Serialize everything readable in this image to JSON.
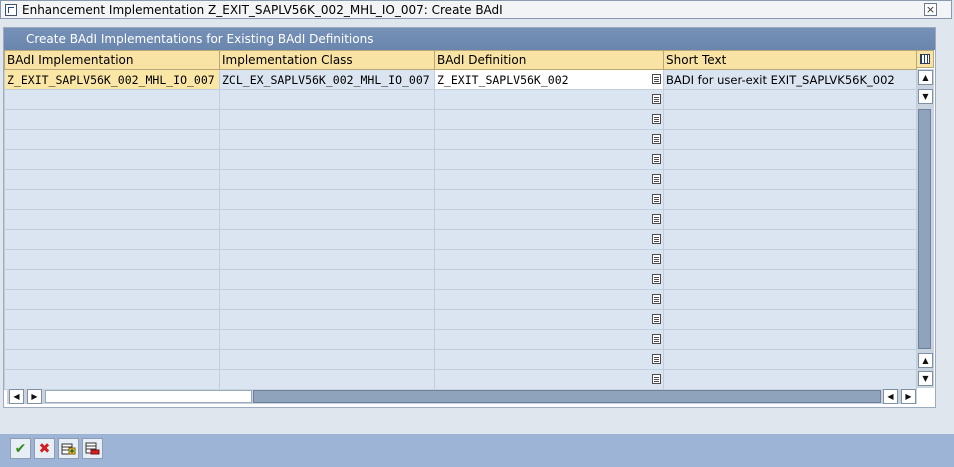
{
  "window": {
    "title": "Enhancement Implementation Z_EXIT_SAPLV56K_002_MHL_IO_007: Create BAdI"
  },
  "panel": {
    "title": "Create BAdI Implementations for Existing BAdI Definitions"
  },
  "table": {
    "columns": [
      "BAdI Implementation",
      "Implementation Class",
      "BAdI Definition",
      "Short Text"
    ],
    "rows": [
      {
        "impl": "Z_EXIT_SAPLV56K_002_MHL_IO_007",
        "cls": "ZCL_EX_SAPLV56K_002_MHL_IO_007",
        "def": "Z_EXIT_SAPLV56K_002",
        "short": "BADI for user-exit EXIT_SAPLVK56K_002"
      },
      {
        "impl": "",
        "cls": "",
        "def": "",
        "short": ""
      },
      {
        "impl": "",
        "cls": "",
        "def": "",
        "short": ""
      },
      {
        "impl": "",
        "cls": "",
        "def": "",
        "short": ""
      },
      {
        "impl": "",
        "cls": "",
        "def": "",
        "short": ""
      },
      {
        "impl": "",
        "cls": "",
        "def": "",
        "short": ""
      },
      {
        "impl": "",
        "cls": "",
        "def": "",
        "short": ""
      },
      {
        "impl": "",
        "cls": "",
        "def": "",
        "short": ""
      },
      {
        "impl": "",
        "cls": "",
        "def": "",
        "short": ""
      },
      {
        "impl": "",
        "cls": "",
        "def": "",
        "short": ""
      },
      {
        "impl": "",
        "cls": "",
        "def": "",
        "short": ""
      },
      {
        "impl": "",
        "cls": "",
        "def": "",
        "short": ""
      },
      {
        "impl": "",
        "cls": "",
        "def": "",
        "short": ""
      },
      {
        "impl": "",
        "cls": "",
        "def": "",
        "short": ""
      },
      {
        "impl": "",
        "cls": "",
        "def": "",
        "short": ""
      },
      {
        "impl": "",
        "cls": "",
        "def": "",
        "short": ""
      }
    ]
  },
  "toolbar": {
    "buttons": [
      {
        "name": "continue-button",
        "icon": "checkmark-icon",
        "color": "#2e8b1e"
      },
      {
        "name": "cancel-button",
        "icon": "cross-icon",
        "color": "#d02020"
      },
      {
        "name": "insert-row-button",
        "icon": "insert-row-icon",
        "color": "#2a6a2a"
      },
      {
        "name": "delete-row-button",
        "icon": "delete-row-icon",
        "color": "#c02020"
      }
    ]
  },
  "colors": {
    "header_bg": "#f8e3a4",
    "cell_bg": "#dae5f1",
    "panel_head": "#6a86ad",
    "bottom_bar": "#9db4d6"
  }
}
